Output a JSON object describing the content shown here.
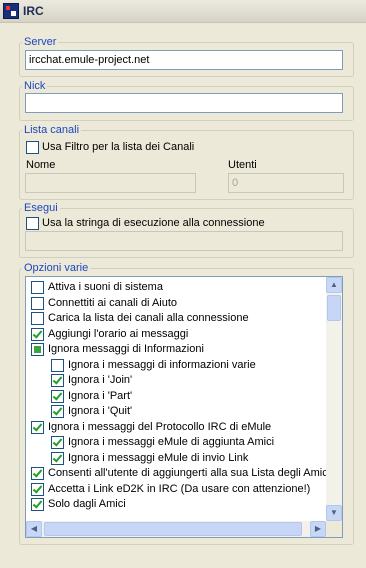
{
  "window": {
    "title": "IRC"
  },
  "server": {
    "label": "Server",
    "value": "ircchat.emule-project.net"
  },
  "nick": {
    "label": "Nick",
    "value": ""
  },
  "channel_list": {
    "label": "Lista canali",
    "filter_checkbox": "Usa Filtro per la lista dei Canali",
    "name_label": "Nome",
    "users_label": "Utenti",
    "name_value": "",
    "users_value": "0"
  },
  "execute": {
    "label": "Esegui",
    "checkbox": "Usa la stringa di esecuzione alla connessione",
    "value": ""
  },
  "options": {
    "label": "Opzioni varie",
    "items": [
      {
        "label": "Attiva i suoni di sistema",
        "state": "unchecked",
        "level": 0
      },
      {
        "label": "Connettiti ai canali di Aiuto",
        "state": "unchecked",
        "level": 0
      },
      {
        "label": "Carica la lista dei canali alla connessione",
        "state": "unchecked",
        "level": 0
      },
      {
        "label": "Aggiungi l'orario ai messaggi",
        "state": "checked",
        "level": 0
      },
      {
        "label": "Ignora messaggi di Informazioni",
        "state": "mixed",
        "level": 0
      },
      {
        "label": "Ignora i messaggi di informazioni varie",
        "state": "unchecked",
        "level": 1
      },
      {
        "label": "Ignora i 'Join'",
        "state": "checked",
        "level": 1
      },
      {
        "label": "Ignora i 'Part'",
        "state": "checked",
        "level": 1
      },
      {
        "label": "Ignora i 'Quit'",
        "state": "checked",
        "level": 1
      },
      {
        "label": "Ignora i messaggi del Protocollo IRC di eMule",
        "state": "checked",
        "level": 0
      },
      {
        "label": "Ignora i messaggi eMule di aggiunta Amici",
        "state": "checked",
        "level": 1
      },
      {
        "label": "Ignora i messaggi eMule di invio Link",
        "state": "checked",
        "level": 1
      },
      {
        "label": "Consenti all'utente di aggiungerti alla sua Lista degli Amici",
        "state": "checked",
        "level": 0
      },
      {
        "label": "Accetta i Link eD2K in IRC (Da usare con attenzione!)",
        "state": "checked",
        "level": 0
      },
      {
        "label": "Solo dagli Amici",
        "state": "checked",
        "level": 0
      }
    ]
  }
}
